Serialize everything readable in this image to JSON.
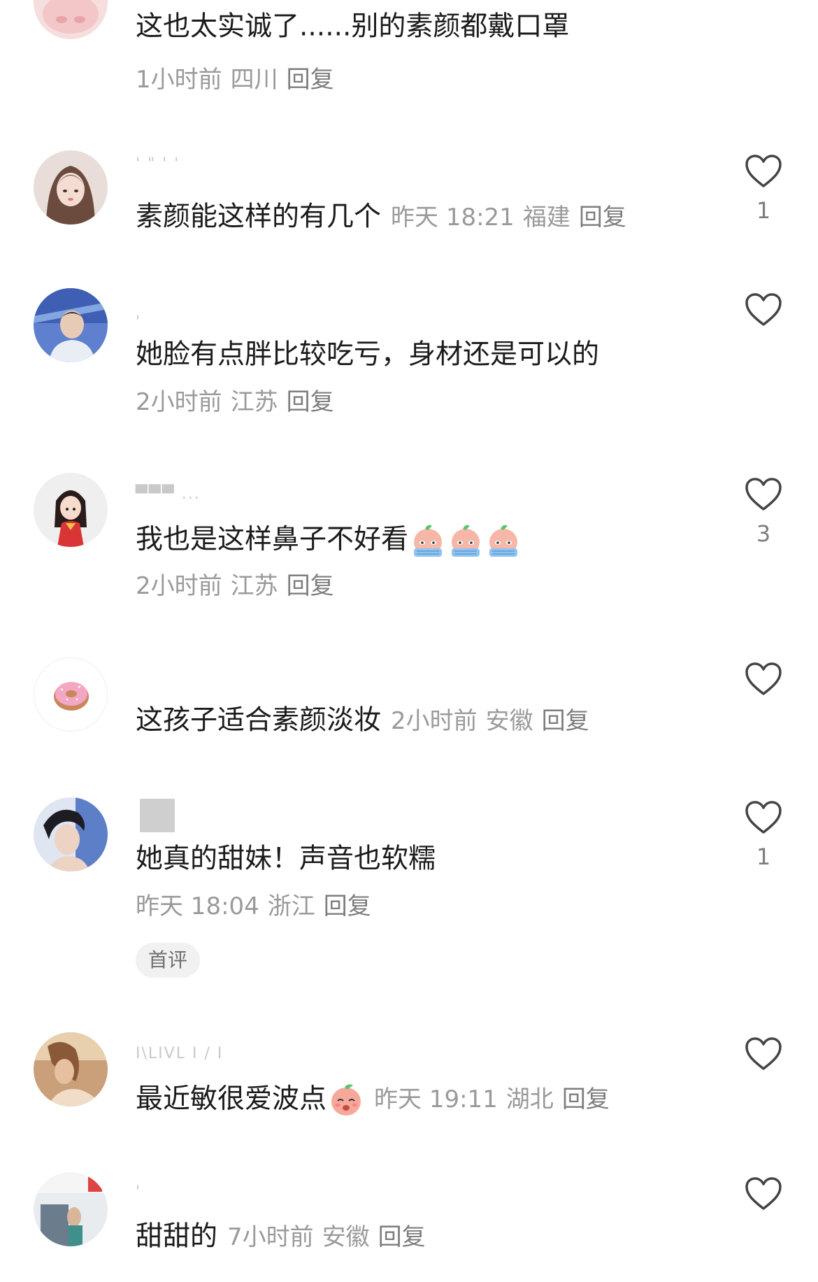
{
  "colors": {
    "text_primary": "#1b1b1b",
    "text_meta": "#9a9a9a",
    "heart_outline": "#444444"
  },
  "comments": [
    {
      "text": "这也太实诚了......别的素颜都戴口罩",
      "time": "1小时前",
      "location": "四川",
      "reply": "回复",
      "avatar_icon": "pink-cartoon-avatar"
    },
    {
      "username": "' \" ' '",
      "text": "素颜能这样的有几个",
      "time": "昨天 18:21",
      "location": "福建",
      "reply": "回复",
      "likes": "1",
      "avatar_icon": "anime-girl-avatar"
    },
    {
      "username": "'",
      "text": "她脸有点胖比较吃亏，身材还是可以的",
      "time": "2小时前",
      "location": "江苏",
      "reply": "回复",
      "avatar_icon": "boy-photo-avatar"
    },
    {
      "username": "▀▀▀ ...",
      "text": "我也是这样鼻子不好看",
      "emojis": [
        "crying-peach-emoji",
        "crying-peach-emoji",
        "crying-peach-emoji"
      ],
      "time": "2小时前",
      "location": "江苏",
      "reply": "回复",
      "likes": "3",
      "avatar_icon": "cartoon-girl-red-dress-avatar"
    },
    {
      "text": "这孩子适合素颜淡妆",
      "time": "2小时前",
      "location": "安徽",
      "reply": "回复",
      "avatar_icon": "donut-avatar"
    },
    {
      "text": "她真的甜妹！声音也软糯",
      "time": "昨天 18:04",
      "location": "浙江",
      "reply": "回复",
      "likes": "1",
      "tag": "首评",
      "avatar_icon": "man-portrait-avatar"
    },
    {
      "username": "I\\LIVL I / I",
      "text": "最近敏很爱波点",
      "emojis": [
        "shy-peach-emoji"
      ],
      "time": "昨天 19:11",
      "location": "湖北",
      "reply": "回复",
      "avatar_icon": "woman-photo-avatar"
    },
    {
      "username": "'",
      "text": "甜甜的",
      "time": "7小时前",
      "location": "安徽",
      "reply": "回复",
      "avatar_icon": "room-photo-avatar"
    }
  ]
}
